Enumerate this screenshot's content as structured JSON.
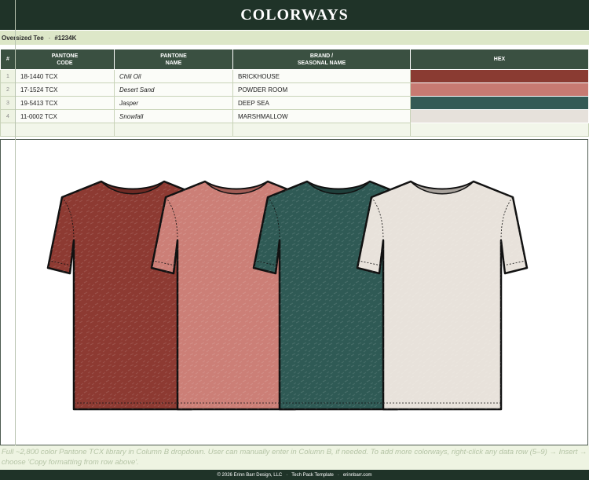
{
  "header": {
    "title": "COLORWAYS"
  },
  "style_info": {
    "style_name": "Oversized Tee",
    "style_number": "#1234K"
  },
  "table": {
    "columns": [
      "#",
      "PANTONE\nCODE",
      "PANTONE\nNAME",
      "BRAND /\nSEASONAL NAME",
      "HEX"
    ],
    "rows": [
      {
        "num": "1",
        "code": "18-1440 TCX",
        "name": "Chili Oil",
        "brand": "BRICKHOUSE",
        "hex": "#8a3b32"
      },
      {
        "num": "2",
        "code": "17-1524 TCX",
        "name": "Desert Sand",
        "brand": "POWDER ROOM",
        "hex": "#c77a72"
      },
      {
        "num": "3",
        "code": "19-5413 TCX",
        "name": "Jasper",
        "brand": "DEEP SEA",
        "hex": "#335a55"
      },
      {
        "num": "4",
        "code": "11-0002 TCX",
        "name": "Snowfall",
        "brand": "MARSHMALLOW",
        "hex": "#e6e1db"
      }
    ]
  },
  "footnote": "Full ~2,800 color Pantone TCX library in Column B dropdown. User can manually enter in Column B, if needed. To add more colorways, right-click any data row (5–9) → Insert → choose 'Copy formatting from row above'.",
  "footer": {
    "copyright": "© 2026 Erinn Barr Design, LLC",
    "template": "Tech Pack Template",
    "site": "erinnbarr.com"
  },
  "colors": {
    "header_bg": "#1f3328",
    "table_header_bg": "#3a5041",
    "subtitle_bg": "#dde7c8"
  },
  "sketches": [
    {
      "name": "tee-sketch-brickhouse",
      "body": "#8d3a32",
      "collar": "#6e2a24"
    },
    {
      "name": "tee-sketch-powder-room",
      "body": "#cc7f77",
      "collar": "#a05c55"
    },
    {
      "name": "tee-sketch-deep-sea",
      "body": "#2f5a55",
      "collar": "#1f3f3b"
    },
    {
      "name": "tee-sketch-marshmallow",
      "body": "#e8e2db",
      "collar": "#a8a29c"
    }
  ]
}
